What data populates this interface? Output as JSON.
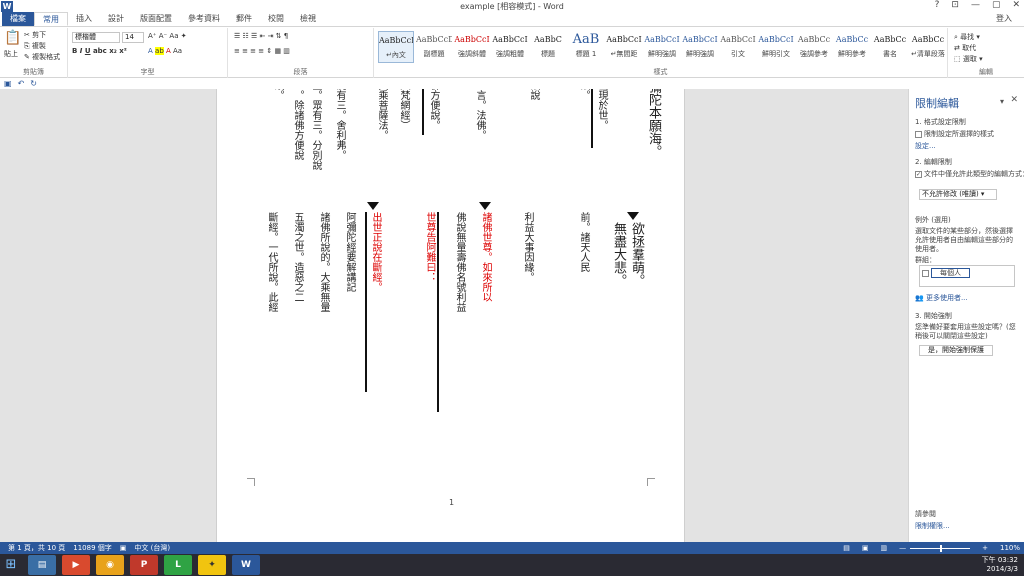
{
  "titlebar": {
    "title": "example [相容模式] - Word",
    "qat_icons": [
      "save-icon",
      "undo-icon",
      "redo-icon"
    ],
    "controls": [
      "?",
      "⊡",
      "—",
      "▢",
      "✕"
    ]
  },
  "tabs": [
    "檔案",
    "常用",
    "插入",
    "設計",
    "版面配置",
    "參考資料",
    "郵件",
    "校閱",
    "檢視"
  ],
  "login": "登入",
  "ribbon": {
    "clipboard": {
      "label": "剪貼簿",
      "paste": "貼上",
      "cut": "剪下",
      "copy": "複製",
      "format_painter": "複製格式"
    },
    "font": {
      "label": "字型",
      "name": "標楷體",
      "size": "14"
    },
    "paragraph": {
      "label": "段落"
    },
    "styles": {
      "label": "樣式",
      "items": [
        {
          "sample": "AaBbCcI",
          "label": "↵內文"
        },
        {
          "sample": "AaBbCcD",
          "label": "副標題"
        },
        {
          "sample": "AaBbCcI",
          "label": "強調斜體"
        },
        {
          "sample": "AaBbCcI",
          "label": "強調粗體"
        },
        {
          "sample": "AaBbC",
          "label": "標題"
        },
        {
          "sample": "AaB",
          "label": "標題 1"
        },
        {
          "sample": "AaBbCcI",
          "label": "↵無間距"
        },
        {
          "sample": "AaBbCcI",
          "label": "鮮明強調"
        },
        {
          "sample": "AaBbCcI",
          "label": "鮮明強調"
        },
        {
          "sample": "AaBbCcI",
          "label": "引文"
        },
        {
          "sample": "AaBbCcI",
          "label": "鮮明引文"
        },
        {
          "sample": "AaBbCc",
          "label": "強調參考"
        },
        {
          "sample": "AaBbCc",
          "label": "鮮明參考"
        },
        {
          "sample": "AaBbCc",
          "label": "書名"
        },
        {
          "sample": "AaBbCc",
          "label": "↵清單段落"
        }
      ]
    },
    "editing": {
      "label": "編輯"
    }
  },
  "document": {
    "page_number": "1",
    "top_cols": [
      "故。",
      "三。除諸佛方便說",
      "重。眾有三。分別說",
      "況有三。舍利弗。",
      "大乘菩薩法。",
      "（梵網經）",
      "佛方便說。",
      "一言。法佛。",
      "法說",
      "出現於世。",
      "法。",
      "彌陀本願海。"
    ],
    "bottom_cols": [
      "斷經。一代所說。此經",
      "五濁之世。造惡之二",
      "諸佛所說的。大乘無量",
      "阿彌陀經要解講記",
      "出世正說在斷經。",
      "世尊告阿難曰：",
      "諸佛世尊。如來所以",
      "佛說無量壽佛名號利益",
      "利益大事因緣。",
      "前。諸天人民",
      "無盡大悲。",
      "欲拯羣萌。"
    ]
  },
  "pane": {
    "title": "限制編輯",
    "s1": "1. 格式設定限制",
    "s1_opt": "限制設定所選擇的樣式",
    "s1_link": "設定...",
    "s2": "2. 編輯限制",
    "s2_opt": "文件中僅允許此類型的編輯方式：",
    "s2_select": "不允許修改 (唯讀)",
    "exceptions": "例外 (選用)",
    "exceptions_desc": "選取文件的某些部分，然後選擇允許使用者自由編輯這些部分的使用者。",
    "group_label": "群組：",
    "everyone": "每個人",
    "more_users": "更多使用者...",
    "s3": "3. 開始強制",
    "s3_desc": "您準備好要套用這些設定嗎？(您稍後可以關閉這些設定)",
    "start_button": "是，開始強制保護",
    "see_also": "請參閱",
    "perm_link": "限制權限..."
  },
  "status": {
    "page": "第 1 頁，共 10 頁",
    "words": "11089 個字",
    "lang": "中文 (台灣)",
    "zoom": "110%"
  },
  "tray": {
    "time": "下午 03:32",
    "date": "2014/3/3"
  }
}
